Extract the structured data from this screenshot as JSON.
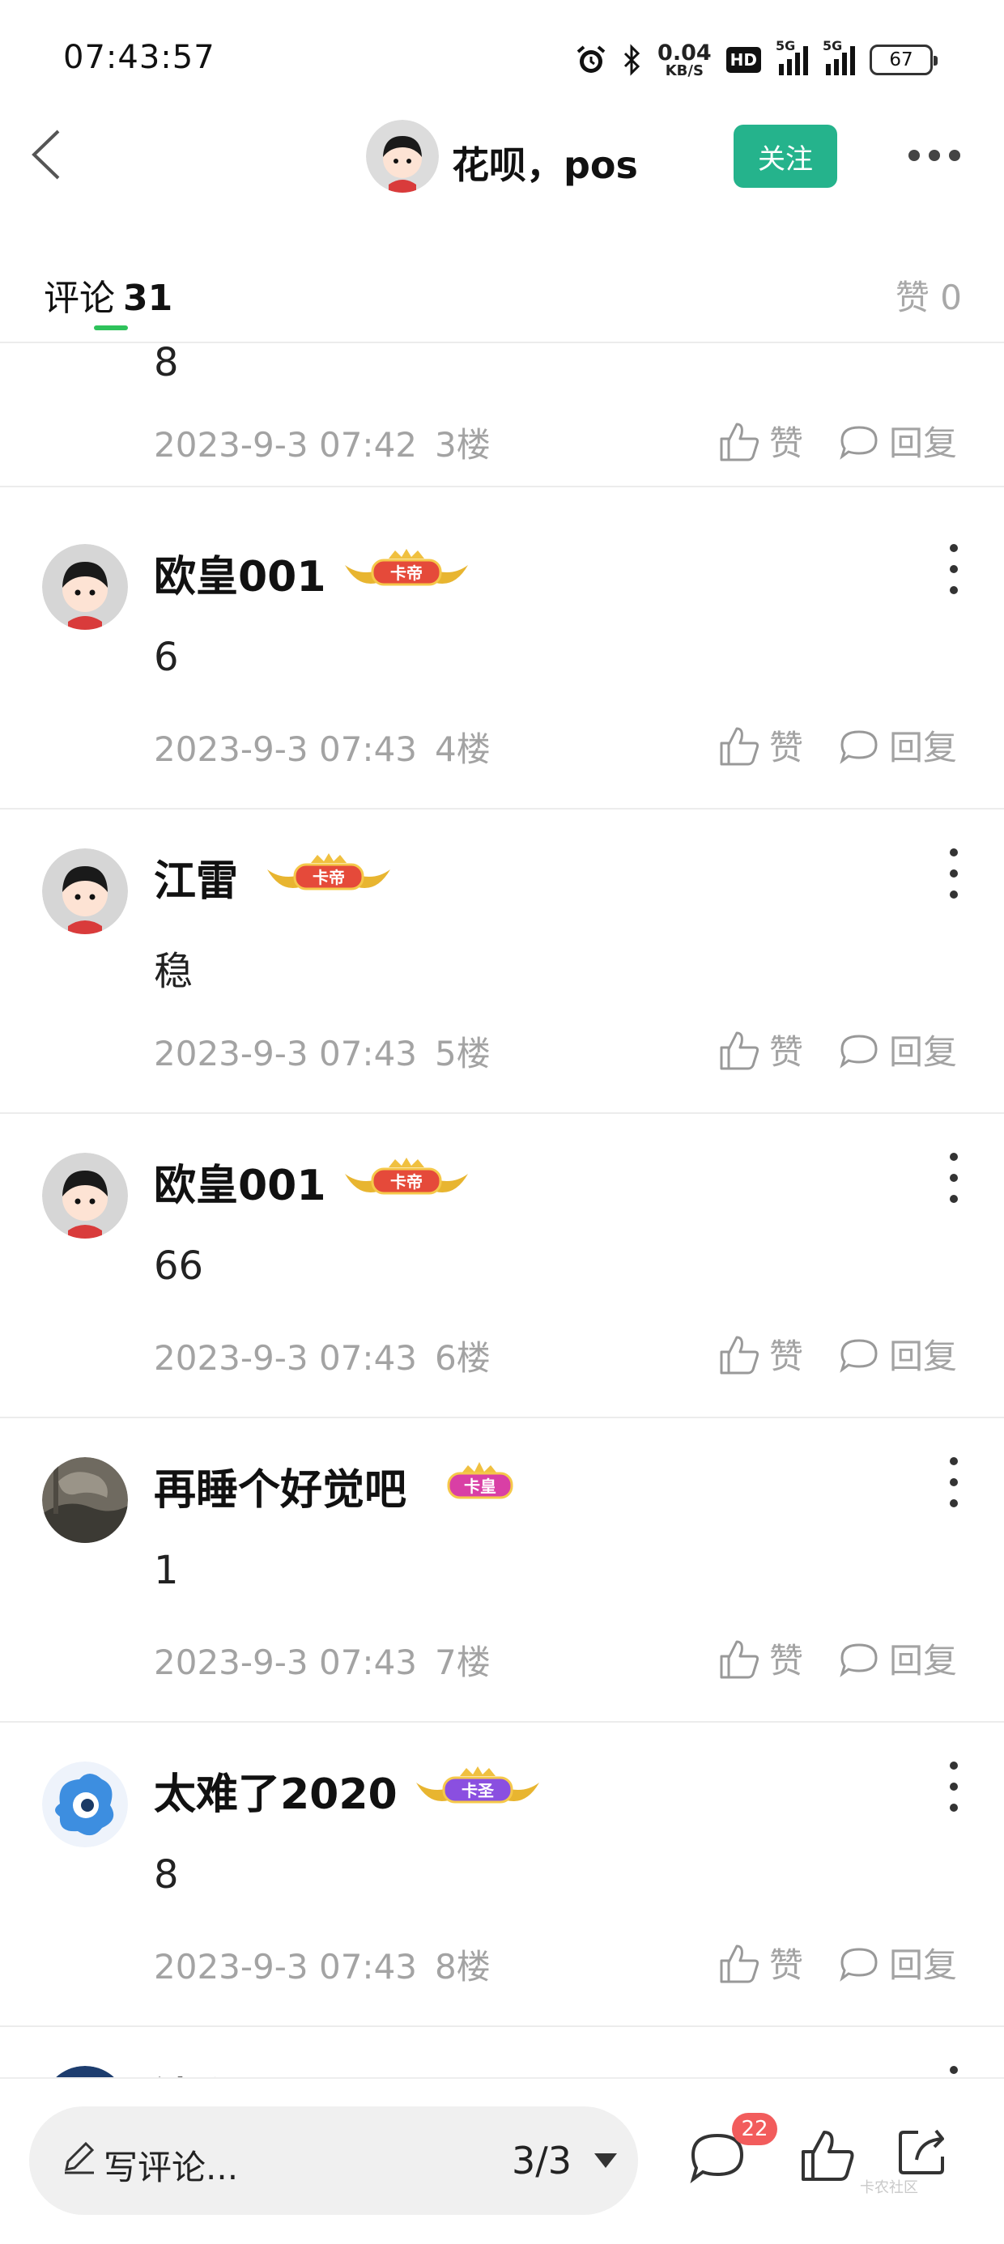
{
  "status_bar": {
    "time": "07:43:57",
    "net_speed_value": "0.04",
    "net_speed_unit": "KB/S",
    "hd_label": "HD",
    "signal1_label": "5G",
    "signal2_label": "5G",
    "battery": "67",
    "icons": [
      "alarm-icon",
      "bluetooth-icon"
    ]
  },
  "nav": {
    "title": "花呗，pos",
    "follow_label": "关注"
  },
  "tabs": {
    "comments_label": "评论",
    "comments_count": "31",
    "likes_label": "赞 0"
  },
  "comments": [
    {
      "name": "",
      "badge": "",
      "body": "8",
      "date": "2023-9-3 07:42",
      "floor": "3楼",
      "like_label": "赞",
      "reply_label": "回复"
    },
    {
      "name": "欧皇001",
      "badge": "卡帝",
      "body": "6",
      "date": "2023-9-3 07:43",
      "floor": "4楼",
      "like_label": "赞",
      "reply_label": "回复"
    },
    {
      "name": "江雷",
      "badge": "卡帝",
      "body": "稳",
      "date": "2023-9-3 07:43",
      "floor": "5楼",
      "like_label": "赞",
      "reply_label": "回复"
    },
    {
      "name": "欧皇001",
      "badge": "卡帝",
      "body": "66",
      "date": "2023-9-3 07:43",
      "floor": "6楼",
      "like_label": "赞",
      "reply_label": "回复"
    },
    {
      "name": "再睡个好觉吧",
      "badge": "卡皇",
      "body": "1",
      "date": "2023-9-3 07:43",
      "floor": "7楼",
      "like_label": "赞",
      "reply_label": "回复"
    },
    {
      "name": "太难了2020",
      "badge": "卡圣",
      "body": "8",
      "date": "2023-9-3 07:43",
      "floor": "8楼",
      "like_label": "赞",
      "reply_label": "回复"
    },
    {
      "name": "沐 酒",
      "badge": "",
      "body": "",
      "date": "",
      "floor": "",
      "like_label": "",
      "reply_label": ""
    }
  ],
  "bottom": {
    "write_placeholder": "写评论...",
    "page_indicator": "3/3",
    "comment_count": "22",
    "watermark": "卡农社区"
  },
  "colors": {
    "accent_green": "#25b38c",
    "tab_indicator": "#2ec25b",
    "badge_red": "#f25c5c",
    "meta_gray": "#a3a3a3"
  }
}
